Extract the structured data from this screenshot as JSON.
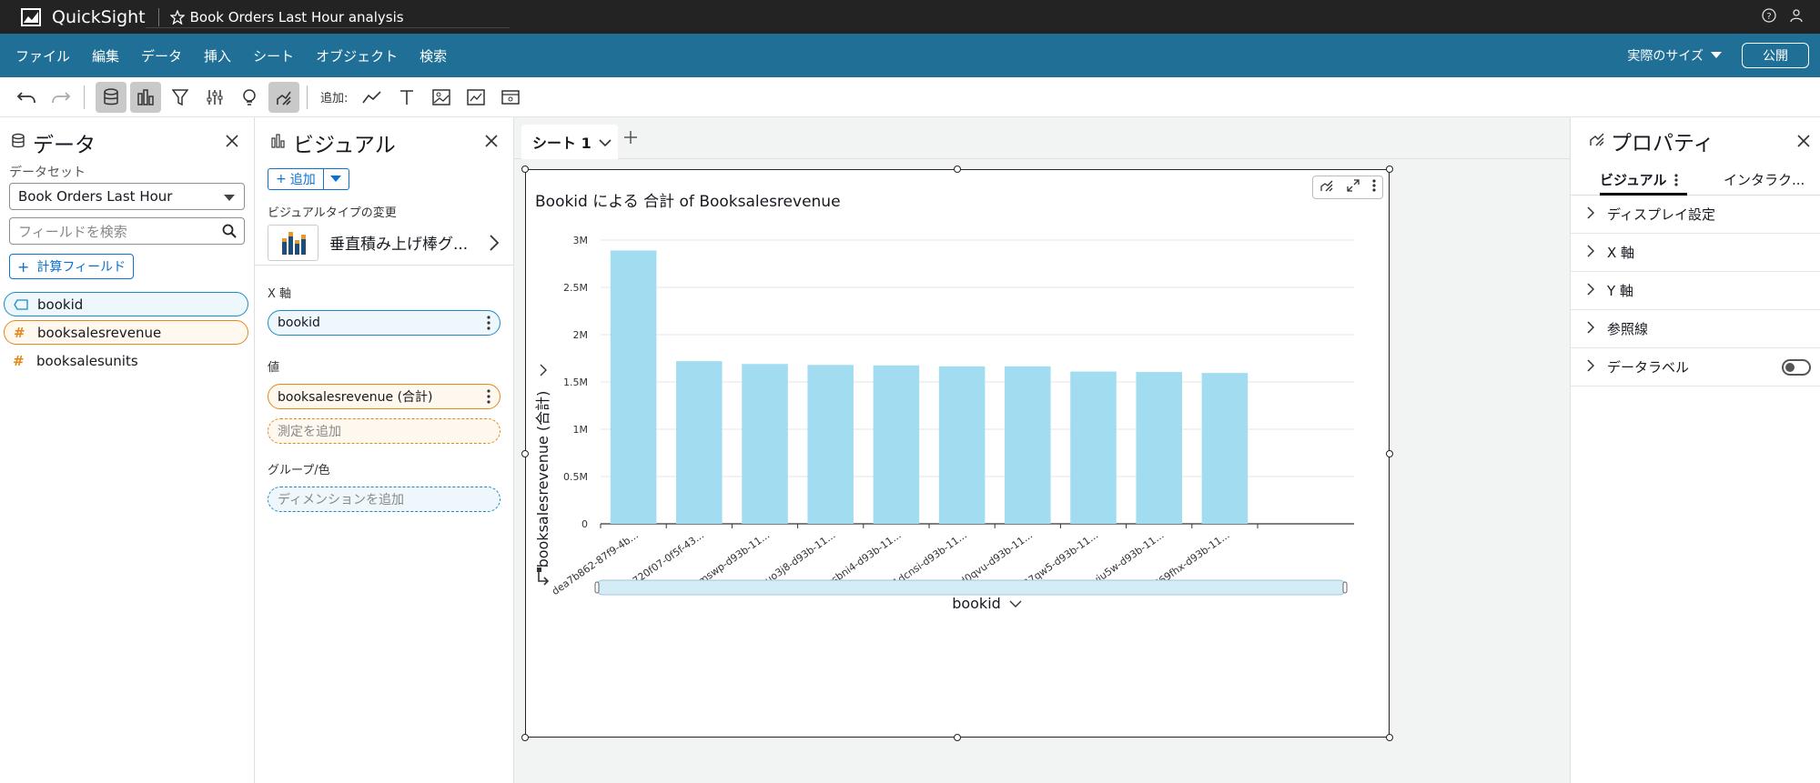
{
  "topbar": {
    "brand": "QuickSight",
    "analysis_title": "Book Orders Last Hour analysis"
  },
  "menubar": {
    "items": [
      "ファイル",
      "編集",
      "データ",
      "挿入",
      "シート",
      "オブジェクト",
      "検索"
    ],
    "size_label": "実際のサイズ",
    "publish_label": "公開"
  },
  "toolbar": {
    "add_label": "追加:"
  },
  "data_panel": {
    "title": "データ",
    "dataset_label": "データセット",
    "dataset_value": "Book Orders Last Hour",
    "search_placeholder": "フィールドを検索",
    "calc_field_label": "計算フィールド",
    "fields": [
      {
        "name": "bookid",
        "type": "dimension"
      },
      {
        "name": "booksalesrevenue",
        "type": "measure"
      },
      {
        "name": "booksalesunits",
        "type": "measure"
      }
    ]
  },
  "visual_panel": {
    "title": "ビジュアル",
    "add_label": "追加",
    "visual_type_label": "ビジュアルタイプの変更",
    "visual_type_name": "垂直積み上げ棒グ...",
    "x_axis_label": "X 軸",
    "x_axis_field": "bookid",
    "value_label": "値",
    "value_field": "booksalesrevenue (合計)",
    "add_measure": "測定を追加",
    "group_label": "グループ/色",
    "add_dimension": "ディメンションを追加"
  },
  "sheet": {
    "tab_label": "シート 1"
  },
  "visual": {
    "title": "Bookid による 合計 of Booksalesrevenue"
  },
  "chart_data": {
    "type": "bar",
    "title": "Bookid による 合計 of Booksalesrevenue",
    "xlabel": "bookid",
    "ylabel": "booksalesrevenue (合計)",
    "categories": [
      "dea7b862-87f9-4b...",
      "18720f07-0f5f-43...",
      "3ymswp-d93b-11...",
      "8zuo3j8-d93b-11...",
      "6ysbni4-d93b-11...",
      "l1dcnsi-d93b-11...",
      "0ld0qvu-d93b-11...",
      "b37qw5-d93b-11...",
      "h9yiu5w-d93b-11...",
      "k769fhx-d93b-11..."
    ],
    "values": [
      2890000,
      1720000,
      1690000,
      1680000,
      1675000,
      1665000,
      1665000,
      1610000,
      1605000,
      1595000
    ],
    "ylim": [
      0,
      3000000
    ],
    "yticks": [
      {
        "v": 0,
        "label": "0"
      },
      {
        "v": 500000,
        "label": "0.5M"
      },
      {
        "v": 1000000,
        "label": "1M"
      },
      {
        "v": 1500000,
        "label": "1.5M"
      },
      {
        "v": 2000000,
        "label": "2M"
      },
      {
        "v": 2500000,
        "label": "2.5M"
      },
      {
        "v": 3000000,
        "label": "3M"
      }
    ],
    "bar_color": "#a2dcf0",
    "grid": true,
    "legend": "none"
  },
  "properties": {
    "title": "プロパティ",
    "tabs": [
      "ビジュアル",
      "インタラク..."
    ],
    "sections": [
      "ディスプレイ設定",
      "X 軸",
      "Y 軸",
      "参照線",
      "データラベル"
    ]
  },
  "colors": {
    "topbar": "#232323",
    "menubar": "#1f6f96",
    "accent": "#0972d3",
    "dimension": "#1a8dc6",
    "measure": "#e08a1c"
  }
}
